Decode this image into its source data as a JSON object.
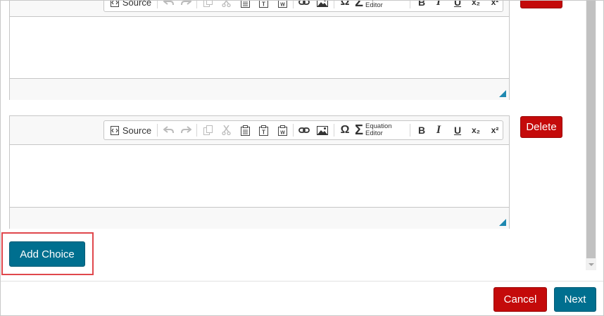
{
  "editor_toolbar": {
    "source_label": "Source",
    "equation_label_line1": "Equation",
    "equation_label_line2": "Editor",
    "bold": "B",
    "italic": "I",
    "underline": "U",
    "subscript": "x₂",
    "superscript": "x²",
    "omega": "Ω",
    "sigma": "Σ"
  },
  "choices": [
    {
      "delete_label": ""
    },
    {
      "delete_label": "Delete"
    }
  ],
  "add_choice_label": "Add Choice",
  "footer": {
    "cancel_label": "Cancel",
    "next_label": "Next"
  },
  "colors": {
    "danger": "#c40a0a",
    "primary": "#006f8f",
    "highlight": "#e0474c",
    "resize_handle": "#1e88b0"
  }
}
